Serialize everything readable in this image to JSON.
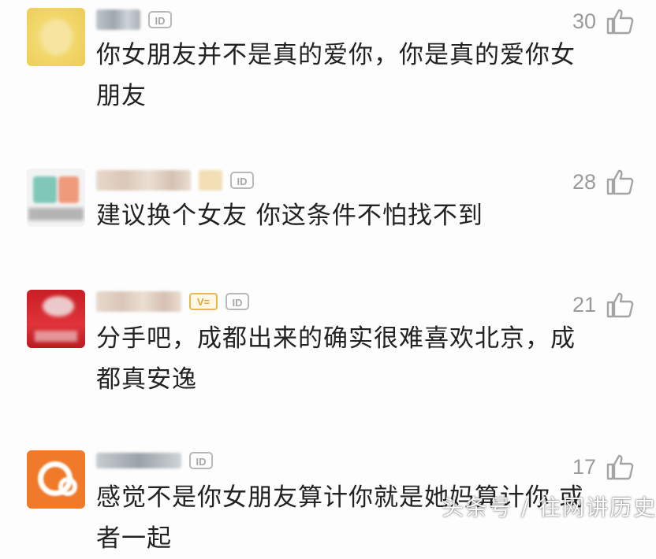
{
  "comments": [
    {
      "likes": "30",
      "text_lines": [
        "你女朋友并不是真的爱你，你是真的爱你女",
        "朋友"
      ],
      "badge_id": "ID",
      "avatar_color": "#f2d86b"
    },
    {
      "likes": "28",
      "text_lines": [
        "建议换个女友 你这条件不怕找不到"
      ],
      "badge_id": "ID",
      "avatar_color": "#7fc8b8"
    },
    {
      "likes": "21",
      "text_lines": [
        "分手吧，成都出来的确实很难喜欢北京，成",
        "都真安逸"
      ],
      "badge_id": "ID",
      "badge_v": "V=",
      "avatar_color": "#d9262c"
    },
    {
      "likes": "17",
      "text_lines": [
        "感觉不是你女朋友算计你就是她妈算计你  或",
        "者一起"
      ],
      "badge_id": "ID",
      "avatar_color": "#f07a2a"
    }
  ],
  "watermark": "头条号 / 往网讲历史",
  "icons": {
    "like": "thumbs-up-icon",
    "id_badge": "id-badge-icon"
  }
}
